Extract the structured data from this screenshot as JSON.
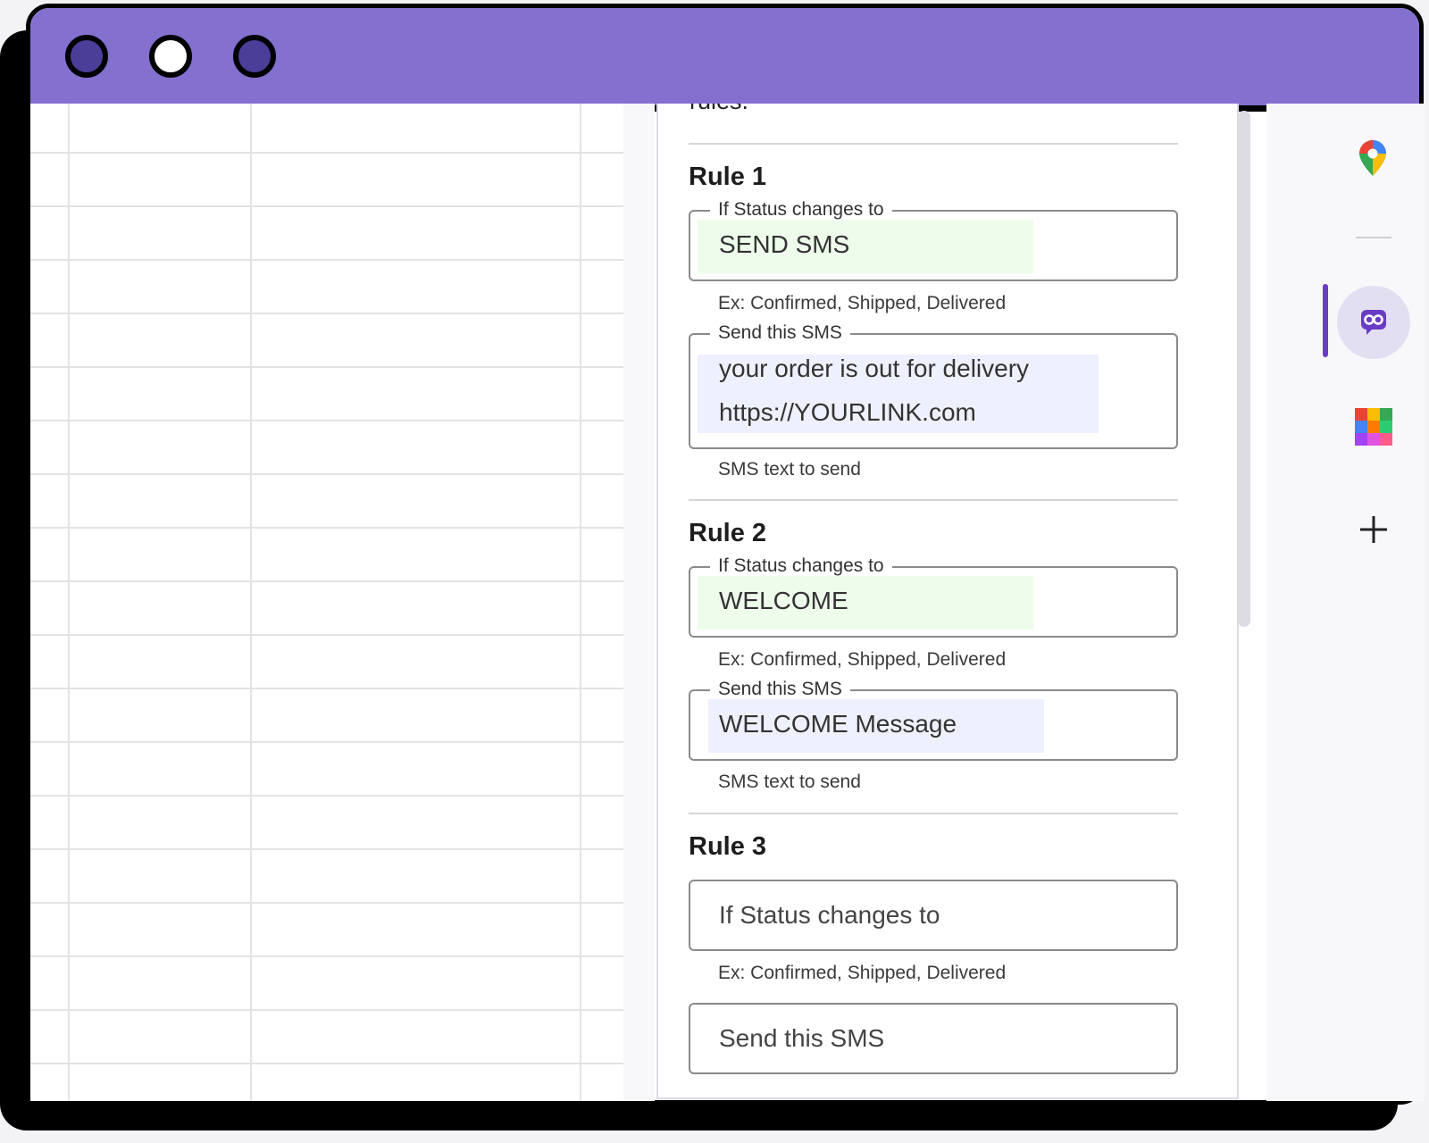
{
  "panel": {
    "intro_tail": "rules.",
    "rules": [
      {
        "title": "Rule 1",
        "status_label": "If Status changes to",
        "status_value": "SEND SMS",
        "status_helper": "Ex: Confirmed, Shipped, Delivered",
        "sms_label": "Send this SMS",
        "sms_line1": "your order is out for delivery",
        "sms_line2": "https://YOURLINK.com",
        "sms_helper": "SMS text to send"
      },
      {
        "title": "Rule 2",
        "status_label": "If Status changes to",
        "status_value": "WELCOME",
        "status_helper": "Ex: Confirmed, Shipped, Delivered",
        "sms_label": "Send this SMS",
        "sms_value": "WELCOME Message",
        "sms_helper": "SMS text to send"
      },
      {
        "title": "Rule 3",
        "status_placeholder": "If Status changes to",
        "status_helper": "Ex: Confirmed, Shipped, Delivered",
        "sms_placeholder": "Send this SMS"
      }
    ]
  },
  "rail": {
    "icons": [
      "maps-pin-icon",
      "sms-addon-icon",
      "color-grid-icon",
      "plus-icon"
    ],
    "active": "sms-addon-icon",
    "accent": "#6a3cc4"
  },
  "window": {
    "titlebar_color": "#8370cf",
    "dots": [
      "dark",
      "light",
      "dark"
    ]
  }
}
